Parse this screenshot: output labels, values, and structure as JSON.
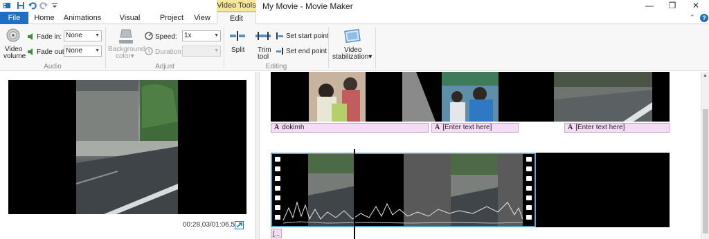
{
  "window": {
    "title": "My Movie - Movie Maker",
    "contextual_tab_group": "Video Tools",
    "controls": {
      "minimize": "—",
      "restore": "❐",
      "close": "✕"
    }
  },
  "quick_access": [
    "save-icon",
    "undo-icon",
    "redo-icon",
    "customize-icon"
  ],
  "tabs": [
    {
      "label": "File",
      "active": false
    },
    {
      "label": "Home",
      "active": false
    },
    {
      "label": "Animations",
      "active": false
    },
    {
      "label": "Visual Effects",
      "active": false
    },
    {
      "label": "Project",
      "active": false
    },
    {
      "label": "View",
      "active": false
    },
    {
      "label": "Edit",
      "active": true
    }
  ],
  "help": "?",
  "ribbon": {
    "audio": {
      "group_label": "Audio",
      "video_volume_line1": "Video",
      "video_volume_line2": "volume",
      "fade_in_label": "Fade in:",
      "fade_in_value": "None",
      "fade_out_label": "Fade out:",
      "fade_out_value": "None"
    },
    "adjust": {
      "group_label": "Adjust",
      "background_color_line1": "Background",
      "background_color_line2": "color",
      "speed_label": "Speed:",
      "speed_value": "1x",
      "duration_label": "Duration:",
      "duration_value": ""
    },
    "editing": {
      "group_label": "Editing",
      "split_label": "Split",
      "trim_tool_line1": "Trim",
      "trim_tool_line2": "tool",
      "set_start_point": "Set start point",
      "set_end_point": "Set end point"
    },
    "stabilization": {
      "line1": "Video",
      "line2": "stabilization"
    }
  },
  "preview": {
    "time": "00:28,03/01:06,51"
  },
  "storyboard": {
    "captions": [
      {
        "text": "dokimh"
      },
      {
        "text": "[Enter text here]"
      },
      {
        "text": "[Enter text here]"
      }
    ],
    "small_caption": "[..."
  },
  "colors": {
    "file_tab": "#1e6fc3",
    "contextual_tab": "#f6e79b",
    "caption_bg": "#f3dcf4",
    "selection_border": "#5aa8d8"
  }
}
